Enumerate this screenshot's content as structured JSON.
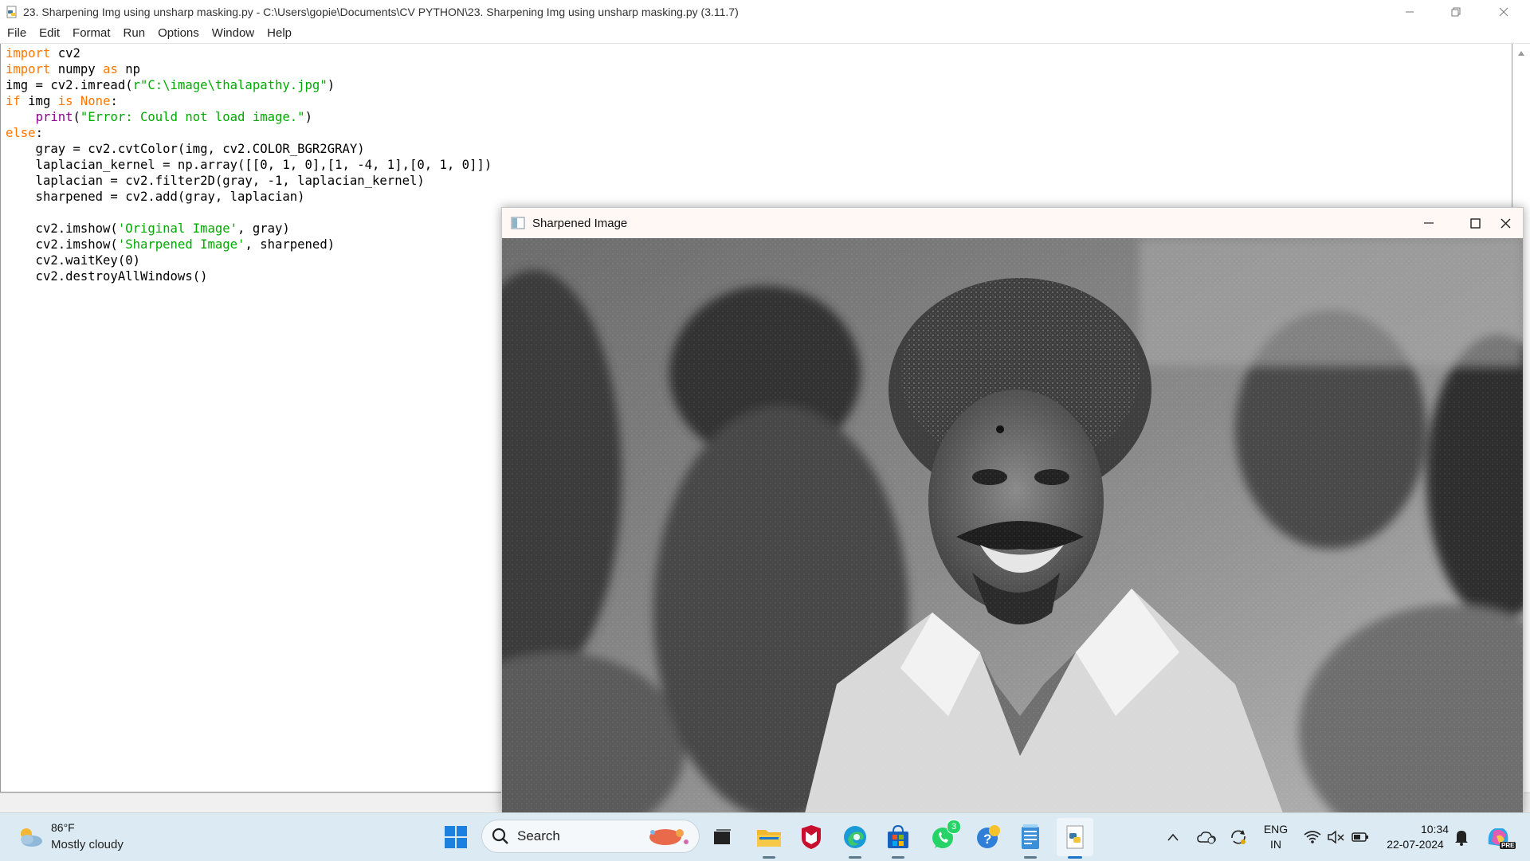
{
  "idle": {
    "title": "23. Sharpening Img using unsharp masking.py - C:\\Users\\gopie\\Documents\\CV PYTHON\\23. Sharpening Img using unsharp masking.py (3.11.7)",
    "menu": [
      "File",
      "Edit",
      "Format",
      "Run",
      "Options",
      "Window",
      "Help"
    ],
    "code_lines": [
      "import cv2",
      "import numpy as np",
      "img = cv2.imread(r\"C:\\image\\thalapathy.jpg\")",
      "if img is None:",
      "    print(\"Error: Could not load image.\")",
      "else:",
      "    gray = cv2.cvtColor(img, cv2.COLOR_BGR2GRAY)",
      "    laplacian_kernel = np.array([[0, 1, 0],[1, -4, 1],[0, 1, 0]])",
      "    laplacian = cv2.filter2D(gray, -1, laplacian_kernel)",
      "    sharpened = cv2.add(gray, laplacian)",
      "",
      "    cv2.imshow('Original Image', gray)",
      "    cv2.imshow('Sharpened Image', sharpened)",
      "    cv2.waitKey(0)",
      "    cv2.destroyAllWindows()"
    ],
    "syntax_colors": {
      "keyword": "#ff7700",
      "builtin": "#900090",
      "string": "#00aa00"
    }
  },
  "cv_window": {
    "title": "Sharpened Image",
    "image_description_icon": "grayscale-photo"
  },
  "taskbar": {
    "weather": {
      "temp": "86°F",
      "desc": "Mostly cloudy"
    },
    "search_label": "Search",
    "whatsapp_badge": "3",
    "lang_top": "ENG",
    "lang_bottom": "IN",
    "time": "10:34",
    "date": "22-07-2024",
    "copilot_badge": "PRE"
  }
}
